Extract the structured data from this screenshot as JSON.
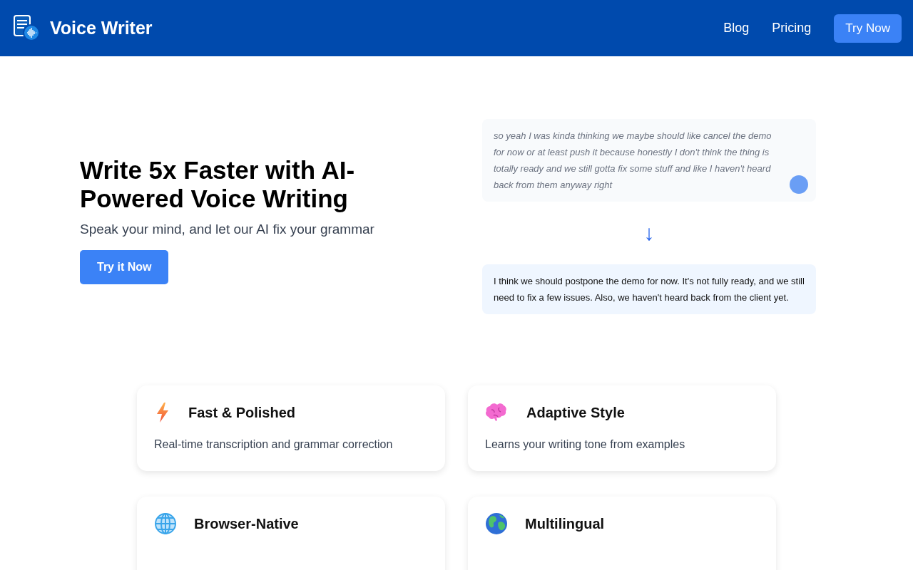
{
  "header": {
    "brand": "Voice Writer",
    "nav": [
      {
        "label": "Blog",
        "kind": "link"
      },
      {
        "label": "Pricing",
        "kind": "link"
      },
      {
        "label": "Try Now",
        "kind": "button"
      }
    ]
  },
  "hero": {
    "title": "Write 5x Faster with AI-Powered Voice Writing",
    "subtitle": "Speak your mind, and let our AI fix your grammar",
    "cta": "Try it Now",
    "raw_text": "so yeah I was kinda thinking we maybe should like cancel the demo for now or at least push it because honestly I don't think the thing is totally ready and we still gotta fix some stuff and like I haven't heard back from them anyway right",
    "arrow": "↓",
    "fixed_text": "I think we should postpone the demo for now. It's not fully ready, and we still need to fix a few issues. Also, we haven't heard back from the client yet."
  },
  "features": [
    {
      "kind": "bolt",
      "title": "Fast & Polished",
      "description": "Real-time transcription and grammar correction"
    },
    {
      "kind": "brain",
      "title": "Adaptive Style",
      "description": "Learns your writing tone from examples"
    },
    {
      "kind": "globe-grid",
      "title": "Browser-Native"
    },
    {
      "kind": "earth",
      "title": "Multilingual"
    }
  ]
}
